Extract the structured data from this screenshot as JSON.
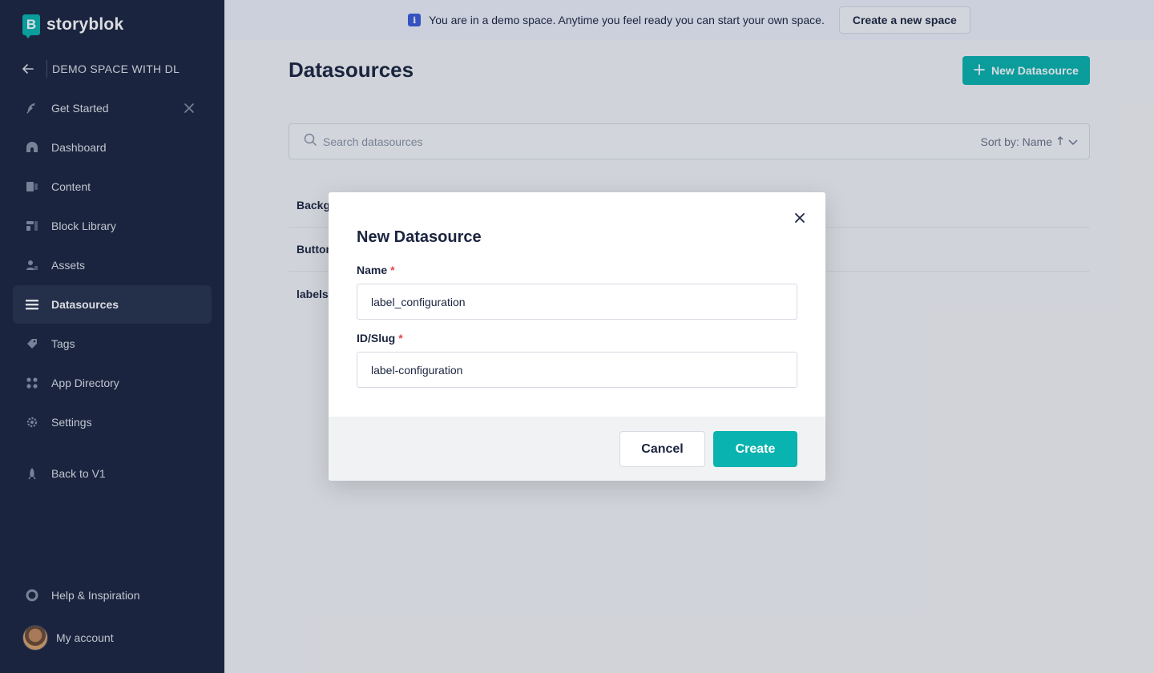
{
  "app": {
    "brand": "storyblok"
  },
  "sidebar": {
    "space_name": "DEMO SPACE WITH DL",
    "items": [
      {
        "label": "Get Started",
        "icon": "rocket-icon",
        "closable": true
      },
      {
        "label": "Dashboard",
        "icon": "dashboard-icon"
      },
      {
        "label": "Content",
        "icon": "content-icon"
      },
      {
        "label": "Block Library",
        "icon": "block-library-icon"
      },
      {
        "label": "Assets",
        "icon": "assets-icon"
      },
      {
        "label": "Datasources",
        "icon": "datasources-icon",
        "active": true
      },
      {
        "label": "Tags",
        "icon": "tag-icon"
      },
      {
        "label": "App Directory",
        "icon": "app-directory-icon"
      },
      {
        "label": "Settings",
        "icon": "gear-icon"
      },
      {
        "label": "Back to V1",
        "icon": "back-to-v1-icon"
      }
    ],
    "help_label": "Help & Inspiration",
    "account_label": "My account"
  },
  "banner": {
    "text": "You are in a demo space. Anytime you feel ready you can start your own space.",
    "button_label": "Create a new space"
  },
  "main": {
    "title": "Datasources",
    "new_button_label": "New Datasource",
    "search_placeholder": "Search datasources",
    "sort_label": "Sort by: Name",
    "rows": [
      "Backgr",
      "Button",
      "labels"
    ]
  },
  "modal": {
    "title": "New Datasource",
    "name_label": "Name",
    "name_value": "label_configuration",
    "slug_label": "ID/Slug",
    "slug_value": "label-configuration",
    "required_marker": "*",
    "cancel_label": "Cancel",
    "create_label": "Create"
  },
  "colors": {
    "sidebar_bg": "#1b243f",
    "accent": "#09b3af",
    "required": "#e5484d"
  }
}
